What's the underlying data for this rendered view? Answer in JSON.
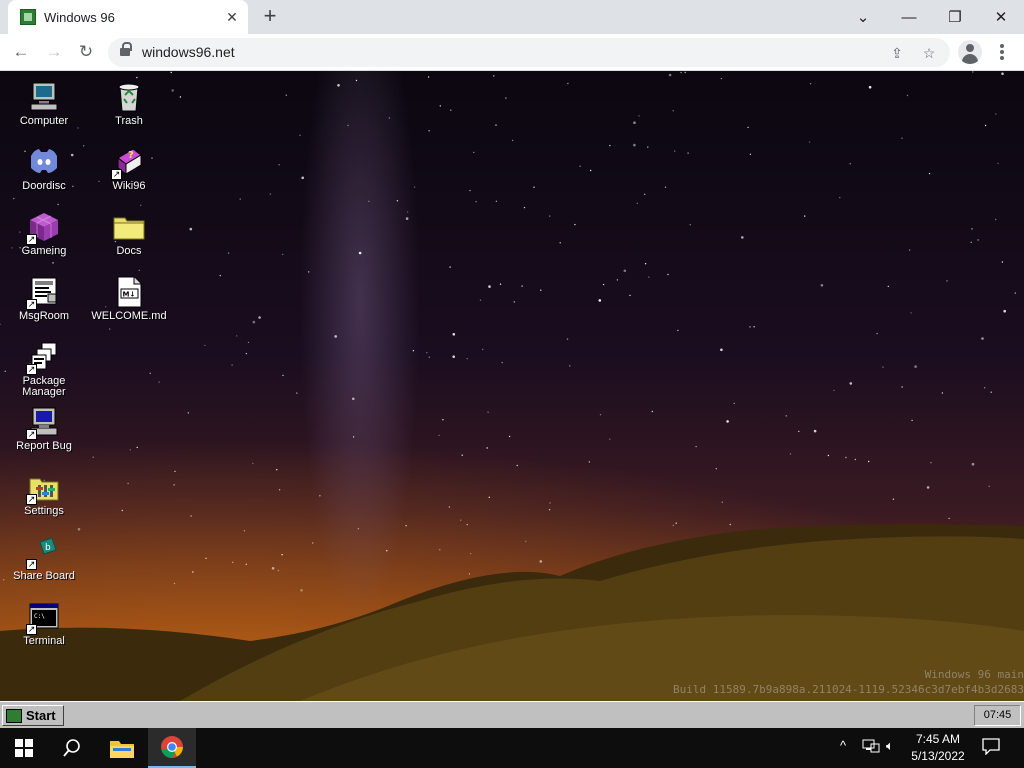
{
  "browser": {
    "tab_title": "Windows 96",
    "url": "windows96.net"
  },
  "desktop": {
    "icons": [
      {
        "label": "Computer",
        "icon": "computer-icon",
        "shortcut": false
      },
      {
        "label": "Trash",
        "icon": "recycle-bin-icon",
        "shortcut": false
      },
      {
        "label": "Doordisc",
        "icon": "discord-icon",
        "shortcut": false
      },
      {
        "label": "Wiki96",
        "icon": "help-book-icon",
        "shortcut": true
      },
      {
        "label": "Gameing",
        "icon": "game-cube-icon",
        "shortcut": true
      },
      {
        "label": "Docs",
        "icon": "folder-icon",
        "shortcut": false
      },
      {
        "label": "MsgRoom",
        "icon": "chat-room-icon",
        "shortcut": true
      },
      {
        "label": "WELCOME.md",
        "icon": "markdown-file-icon",
        "shortcut": false
      },
      {
        "label": "Package Manager",
        "icon": "package-icon",
        "shortcut": true
      },
      {
        "label": "Report Bug",
        "icon": "report-bug-icon",
        "shortcut": true
      },
      {
        "label": "Settings",
        "icon": "settings-icon",
        "shortcut": true
      },
      {
        "label": "Share Board",
        "icon": "share-board-icon",
        "shortcut": true
      },
      {
        "label": "Terminal",
        "icon": "terminal-icon",
        "shortcut": true
      }
    ],
    "version_line": "Windows 96 main",
    "build_line": "Build 11589.7b9a898a.211024-1119.52346c3d7ebf4b3d2683"
  },
  "w96_taskbar": {
    "start_label": "Start",
    "clock": "07:45"
  },
  "win10_taskbar": {
    "time": "7:45 AM",
    "date": "5/13/2022"
  },
  "colors": {
    "w96_gray": "#c0c0c0",
    "chrome_tab_bg": "#dee1e6",
    "win10_accent": "#76b9ed"
  }
}
